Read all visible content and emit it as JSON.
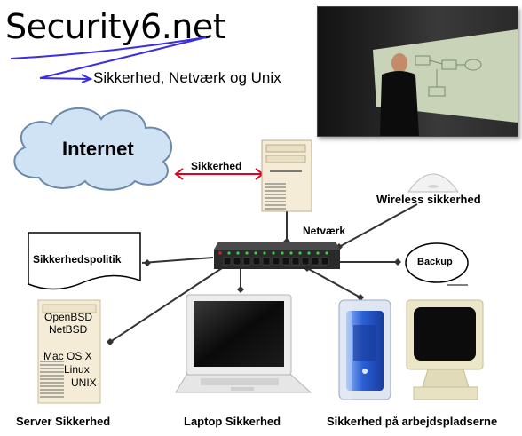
{
  "header": {
    "brand": "Security6.net",
    "tagline": "Sikkerhed, Netværk og Unix"
  },
  "photo": {
    "description_icon": "presenter-photo"
  },
  "cloud": {
    "label": "Internet"
  },
  "links": {
    "firewall_label": "Sikkerhed",
    "switch_label": "Netværk",
    "wireless_label": "Wireless sikkerhed",
    "backup_label": "Backup",
    "policy_label": "Sikkerhedspolitik"
  },
  "server": {
    "os_list": [
      "OpenBSD",
      "NetBSD",
      "Mac OS X",
      "Linux",
      "UNIX"
    ],
    "caption": "Server Sikkerhed"
  },
  "laptop": {
    "caption": "Laptop Sikkerhed"
  },
  "workstations": {
    "caption": "Sikkerhed på arbejdspladserne"
  },
  "colors": {
    "cloud_fill": "#cfe3f5",
    "cloud_stroke": "#6b89a8",
    "firewall_line": "#e0001b",
    "accent_purple": "#3b2ee0",
    "switch_body": "#2a2a2a",
    "switch_led": "#38d040",
    "connector": "#333333"
  }
}
